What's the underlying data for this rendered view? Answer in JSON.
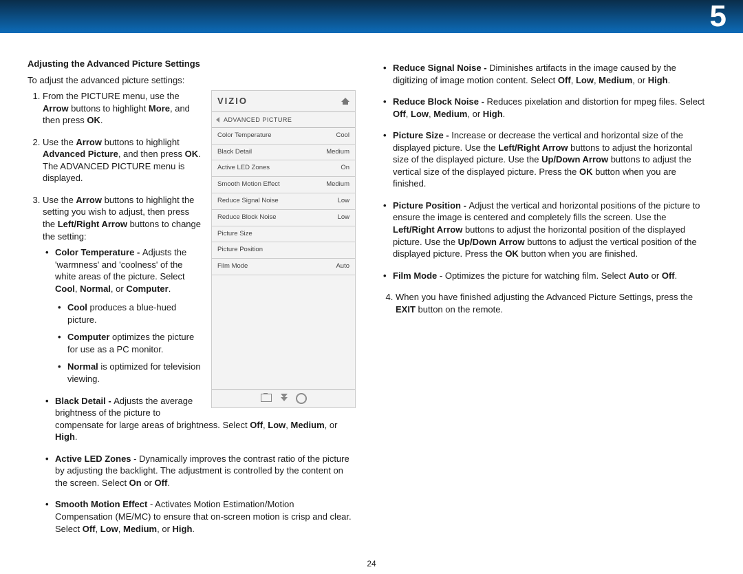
{
  "chapter": "5",
  "pageNumber": "24",
  "heading": "Adjusting the Advanced Picture Settings",
  "intro": "To adjust the advanced picture settings:",
  "steps": {
    "s1a": "From the PICTURE menu, use the ",
    "s1b": "Arrow",
    "s1c": " buttons to highlight ",
    "s1d": "More",
    "s1e": ", and then press ",
    "s1f": "OK",
    "s1g": ".",
    "s2a": "Use the ",
    "s2b": "Arrow",
    "s2c": " buttons to highlight ",
    "s2d": "Advanced Picture",
    "s2e": ", and then press ",
    "s2f": "OK",
    "s2g": ". The ADVANCED PICTURE menu is displayed.",
    "s3a": "Use the ",
    "s3b": "Arrow",
    "s3c": " buttons to highlight the setting you wish to adjust, then press the ",
    "s3d": "Left/Right Arrow",
    "s3e": " buttons to change the setting:",
    "s4a": "When you have finished adjusting the Advanced Picture Settings, press the ",
    "s4b": "EXIT",
    "s4c": " button on the remote."
  },
  "bl1": {
    "ct_t": "Color Temperature - ",
    "ct_d": "Adjusts the 'warmness' and 'coolness' of the white areas of the picture. Select ",
    "ct_o1": "Cool",
    "ct_o1s": ", ",
    "ct_o2": "Normal",
    "ct_o2s": ", or ",
    "ct_o3": "Computer",
    "ct_end": ".",
    "cool_t": "Cool",
    "cool_d": " produces a blue-hued picture.",
    "comp_t": "Computer",
    "comp_d": " optimizes the picture for use as a PC monitor.",
    "norm_t": "Normal",
    "norm_d": " is optimized for television viewing.",
    "bd_t": "Black Detail - ",
    "bd_d": "Adjusts the average brightness of the picture to compensate for large areas of brightness. Select ",
    "bd_o1": "Off",
    "c1": ", ",
    "bd_o2": "Low",
    "c2": ", ",
    "bd_o3": "Medium",
    "c3": ", or ",
    "bd_o4": "High",
    "bd_end": ".",
    "al_t": "Active LED Zones",
    "al_sep": " - ",
    "al_d": "Dynamically improves the contrast ratio of the picture by adjusting the backlight. The adjustment is controlled by the content on the screen. Select ",
    "al_o1": "On",
    "al_or": " or ",
    "al_o2": "Off",
    "al_end": ".",
    "sm_t": "Smooth Motion Effect",
    "sm_sep": " - ",
    "sm_d": "Activates Motion Estimation/Motion Compensation (ME/MC) to ensure that on-screen motion is crisp and clear. Select ",
    "sm_o1": "Off",
    "sm_c1": ", ",
    "sm_o2": "Low",
    "sm_c2": ", ",
    "sm_o3": "Medium",
    "sm_c3": ", or ",
    "sm_o4": "High",
    "sm_end": "."
  },
  "bl2": {
    "rs_t": "Reduce Signal Noise - ",
    "rs_d": "Diminishes artifacts in the image caused by the digitizing of image motion content. Select ",
    "rs_o1": "Off",
    "rs_c1": ", ",
    "rs_o2": "Low",
    "rs_c2": ", ",
    "rs_o3": "Medium",
    "rs_c3": ", or ",
    "rs_o4": "High",
    "rs_end": ".",
    "rb_t": "Reduce Block Noise - ",
    "rb_d": "Reduces pixelation and distortion for mpeg files. Select ",
    "rb_o1": "Off",
    "rb_c1": ", ",
    "rb_o2": "Low",
    "rb_c2": ", ",
    "rb_o3": "Medium",
    "rb_c3": ", or ",
    "rb_o4": "High",
    "rb_end": ".",
    "ps_t": "Picture Size - ",
    "ps_d1": "Increase or decrease the vertical and horizontal size of the displayed picture. Use the ",
    "ps_b1": "Left/Right Arrow",
    "ps_d2": " buttons to adjust the horizontal size of the displayed picture. Use the ",
    "ps_b2": "Up/Down Arrow",
    "ps_d3": " buttons to adjust the vertical size of the displayed picture. Press the ",
    "ps_b3": "OK",
    "ps_d4": " button when you are finished.",
    "pp_t": "Picture Position - ",
    "pp_d1": "Adjust the vertical and horizontal positions of the picture to ensure the image is centered and completely fills the screen. Use the ",
    "pp_b1": "Left/Right Arrow",
    "pp_d2": " buttons to adjust the horizontal position of the displayed picture. Use the ",
    "pp_b2": "Up/Down Arrow",
    "pp_d3": " buttons to adjust the vertical position of the displayed picture. Press the ",
    "pp_b3": "OK",
    "pp_d4": " button when you are finished.",
    "fm_t": "Film Mode",
    "fm_sep": " - ",
    "fm_d": "Optimizes the picture for watching film. Select ",
    "fm_o1": "Auto",
    "fm_or": " or ",
    "fm_o2": "Off",
    "fm_end": "."
  },
  "menu": {
    "logo": "VIZIO",
    "title": "ADVANCED PICTURE",
    "rows": [
      {
        "label": "Color Temperature",
        "value": "Cool"
      },
      {
        "label": "Black Detail",
        "value": "Medium"
      },
      {
        "label": "Active LED Zones",
        "value": "On"
      },
      {
        "label": "Smooth Motion Effect",
        "value": "Medium"
      },
      {
        "label": "Reduce Signal Noise",
        "value": "Low"
      },
      {
        "label": "Reduce Block Noise",
        "value": "Low"
      },
      {
        "label": "Picture Size",
        "value": ""
      },
      {
        "label": "Picture Position",
        "value": ""
      },
      {
        "label": "Film Mode",
        "value": "Auto"
      }
    ]
  }
}
